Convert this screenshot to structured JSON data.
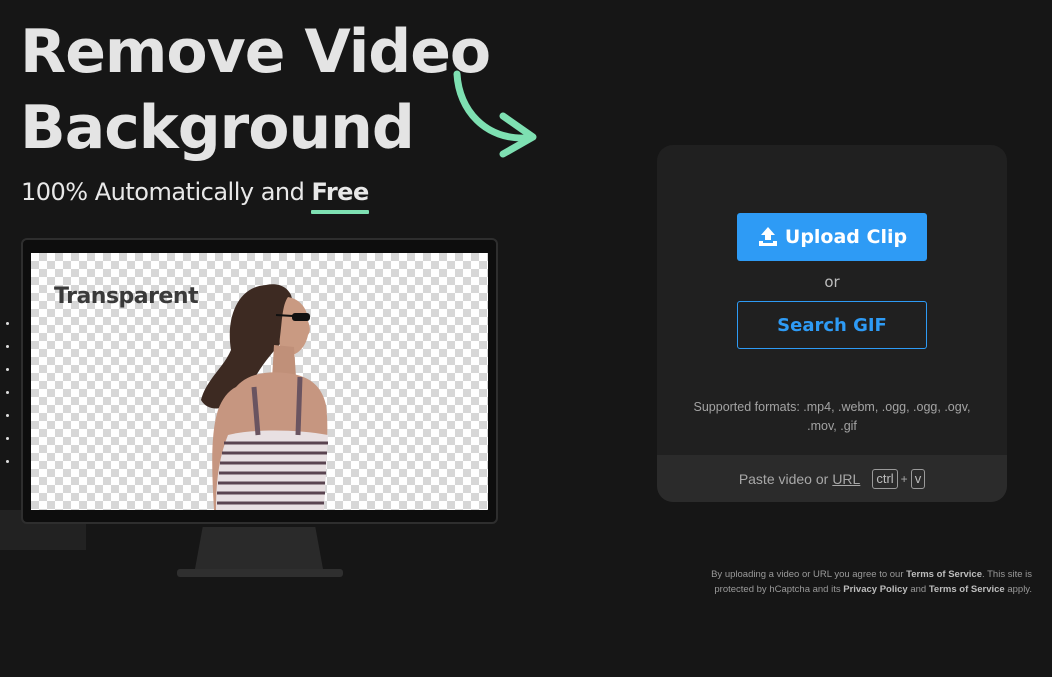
{
  "hero": {
    "title_line1": "Remove Video",
    "title_line2": "Background",
    "subtitle_prefix": "100% Automatically and ",
    "subtitle_emphasis": "Free"
  },
  "preview": {
    "label": "Transparent"
  },
  "upload": {
    "upload_button_label": "Upload Clip",
    "or_label": "or",
    "search_gif_label": "Search GIF",
    "formats_text": "Supported formats: .mp4, .webm, .ogg, .ogg, .ogv, .mov, .gif",
    "paste_prefix": "Paste video or",
    "paste_url_label": "URL",
    "key_ctrl": "ctrl",
    "key_plus": "+",
    "key_v": "v"
  },
  "legal": {
    "text1": "By uploading a video or URL you agree to our ",
    "tos1": "Terms of Service",
    "text2": ". This site is protected by hCaptcha and its ",
    "privacy": "Privacy Policy",
    "text3": " and ",
    "tos2": "Terms of Service",
    "text4": " apply."
  },
  "colors": {
    "accent_blue": "#2e9bf5",
    "accent_green": "#7ee0b2",
    "background": "#161616",
    "card": "#202020"
  },
  "icons": {
    "upload": "upload-icon",
    "arrow": "curved-arrow-icon"
  }
}
